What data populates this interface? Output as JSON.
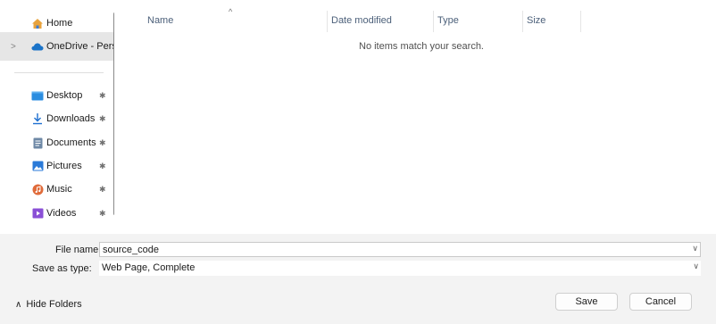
{
  "nav": {
    "items": [
      {
        "label": "Home",
        "icon": "home-icon",
        "pinned": false
      },
      {
        "label": "OneDrive - Pers",
        "icon": "onedrive-icon",
        "pinned": false,
        "selected": true,
        "expandable": true
      },
      {
        "label": "Desktop",
        "icon": "desktop-icon",
        "pinned": true
      },
      {
        "label": "Downloads",
        "icon": "download-icon",
        "pinned": true
      },
      {
        "label": "Documents",
        "icon": "documents-icon",
        "pinned": true
      },
      {
        "label": "Pictures",
        "icon": "pictures-icon",
        "pinned": true
      },
      {
        "label": "Music",
        "icon": "music-icon",
        "pinned": true
      },
      {
        "label": "Videos",
        "icon": "videos-icon",
        "pinned": true
      }
    ],
    "expand_glyph": ">",
    "pin_glyph": "✱"
  },
  "list": {
    "columns": {
      "name": "Name",
      "date_modified": "Date modified",
      "type": "Type",
      "size": "Size"
    },
    "sort_glyph": "^",
    "empty_message": "No items match your search."
  },
  "form": {
    "file_name_label": "File name:",
    "file_name_value": "source_code",
    "save_as_type_label": "Save as type:",
    "save_as_type_value": "Web Page, Complete",
    "dropdown_glyph": "∨"
  },
  "footer": {
    "hide_folders": "Hide Folders",
    "hide_folders_glyph": "∧",
    "save": "Save",
    "cancel": "Cancel"
  },
  "colors": {
    "home": "#e8a33d",
    "onedrive": "#1a73c8",
    "desktop": "#2b8de0",
    "downloads": "#1d6fd0",
    "documents": "#6e88a6",
    "pictures": "#2a7ad8",
    "music": "#e06b3a",
    "videos": "#8a4fd6",
    "column_text": "#4c607a"
  }
}
